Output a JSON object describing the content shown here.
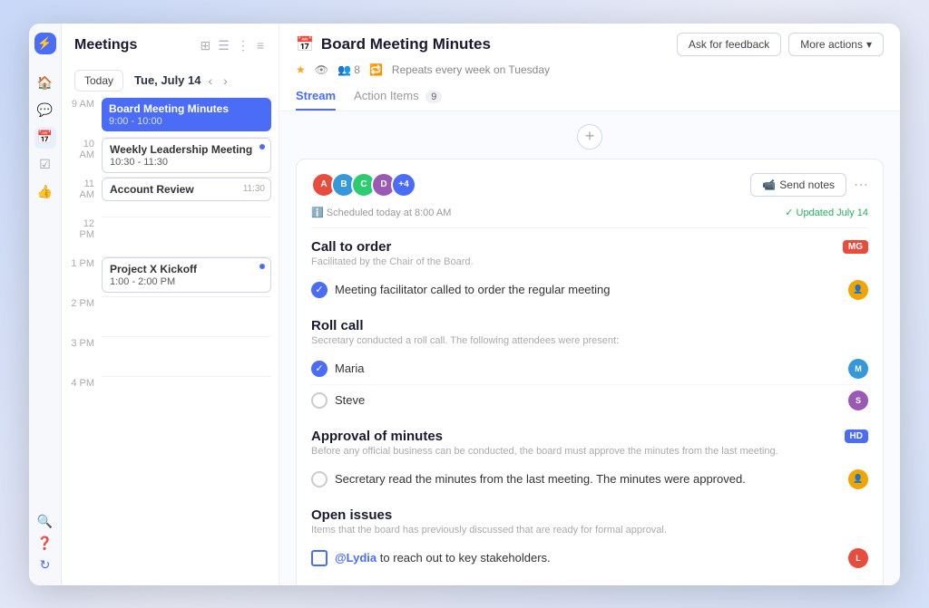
{
  "app": {
    "title": "Meetings",
    "window_dots": [
      "#ff5f57",
      "#ffbd2e",
      "#28c840"
    ]
  },
  "sidebar": {
    "today_btn": "Today",
    "date_label": "Tue, July 14",
    "time_slots": [
      {
        "label": "9 AM",
        "events": []
      },
      {
        "label": "10 AM",
        "events": []
      },
      {
        "label": "11 AM",
        "events": []
      },
      {
        "label": "12 PM",
        "events": []
      },
      {
        "label": "1 PM",
        "events": []
      },
      {
        "label": "2 PM",
        "events": []
      },
      {
        "label": "3 PM",
        "events": []
      },
      {
        "label": "4 PM",
        "events": []
      }
    ],
    "events": [
      {
        "title": "Board Meeting Minutes",
        "time": "9:00 - 10:00",
        "style": "blue"
      },
      {
        "title": "Weekly Leadership Meeting",
        "time": "10:30 - 11:30",
        "style": "outline",
        "dot": true
      },
      {
        "title": "Account Review",
        "time": "11:30",
        "style": "outline",
        "badge": "11:30"
      },
      {
        "title": "Project X Kickoff",
        "time": "1:00 - 2:00 PM",
        "style": "outline",
        "dot": true
      }
    ]
  },
  "main": {
    "header": {
      "title": "Board Meeting Minutes",
      "icon": "📅",
      "repeats": "Repeats every week on Tuesday",
      "feedback_btn": "Ask for feedback",
      "more_btn": "More actions",
      "scheduled": "Scheduled today at 8:00 AM",
      "updated": "Updated July 14"
    },
    "tabs": [
      {
        "label": "Stream",
        "active": true
      },
      {
        "label": "Action Items",
        "badge": "9"
      }
    ],
    "card": {
      "send_notes_btn": "Send notes",
      "sections": [
        {
          "id": "call-to-order",
          "title": "Call to order",
          "badge": "MG",
          "badge_color": "red",
          "subtitle": "Facilitated by the Chair of the Board.",
          "items": [
            {
              "text": "Meeting facilitator called to order the regular meeting",
              "checked": true,
              "type": "circle"
            }
          ]
        },
        {
          "id": "roll-call",
          "title": "Roll call",
          "badge": null,
          "subtitle": "Secretary conducted a roll call. The following attendees were present:",
          "items": [
            {
              "text": "Maria",
              "checked": true,
              "type": "circle"
            },
            {
              "text": "Steve",
              "checked": false,
              "type": "circle"
            }
          ]
        },
        {
          "id": "approval-of-minutes",
          "title": "Approval of minutes",
          "badge": "HD",
          "badge_color": "blue",
          "subtitle": "Before any official business can be conducted, the board must approve the minutes from the last meeting.",
          "items": [
            {
              "text": "Secretary read the minutes from the last meeting. The minutes were approved.",
              "checked": false,
              "type": "circle"
            }
          ]
        },
        {
          "id": "open-issues",
          "title": "Open issues",
          "badge": null,
          "subtitle": "Items that the board has previously discussed that are ready for formal approval.",
          "items": [
            {
              "text": "@Lydia to reach out to key stakeholders.",
              "checked": false,
              "type": "square",
              "mention": "@Lydia"
            }
          ]
        }
      ]
    }
  }
}
